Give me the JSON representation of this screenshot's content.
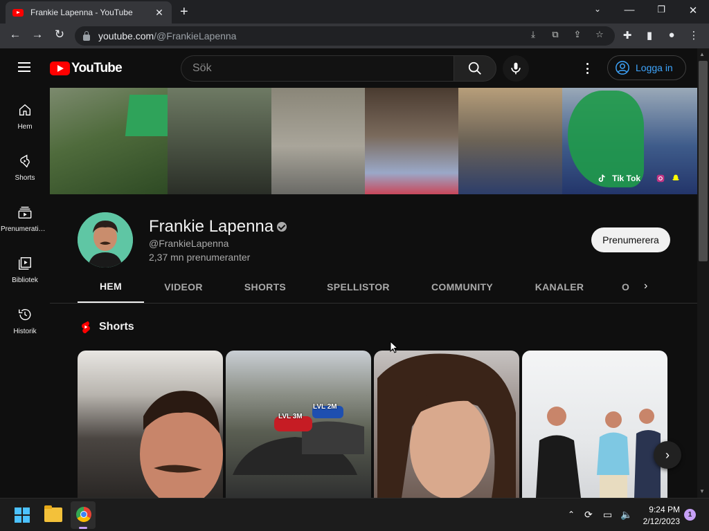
{
  "browser": {
    "tab_title": "Frankie Lapenna - YouTube",
    "url_host": "youtube.com",
    "url_path": "/@FrankieLapenna"
  },
  "masthead": {
    "logo_text": "YouTube",
    "search_placeholder": "Sök",
    "login_label": "Logga in"
  },
  "guide": {
    "items": [
      {
        "label": "Hem",
        "icon": "home-icon"
      },
      {
        "label": "Shorts",
        "icon": "shorts-icon"
      },
      {
        "label": "Prenumerationer",
        "icon": "subscriptions-icon"
      },
      {
        "label": "Bibliotek",
        "icon": "library-icon"
      },
      {
        "label": "Historik",
        "icon": "history-icon"
      }
    ]
  },
  "banner": {
    "social_label": "Tik Tok"
  },
  "channel": {
    "name": "Frankie Lapenna",
    "handle": "@FrankieLapenna",
    "subscribers": "2,37 mn prenumeranter",
    "subscribe_label": "Prenumerera"
  },
  "tabs": [
    {
      "label": "HEM",
      "active": true
    },
    {
      "label": "VIDEOR",
      "active": false
    },
    {
      "label": "SHORTS",
      "active": false
    },
    {
      "label": "SPELLISTOR",
      "active": false
    },
    {
      "label": "COMMUNITY",
      "active": false
    },
    {
      "label": "KANALER",
      "active": false
    },
    {
      "label": "O",
      "active": false
    }
  ],
  "shelf": {
    "title": "Shorts",
    "overlay_labels": [
      "LVL 3M",
      "LVL 2M"
    ]
  },
  "taskbar": {
    "time": "9:24 PM",
    "date": "2/12/2023",
    "notifications": "1"
  },
  "colors": {
    "accent_red": "#ff0000",
    "link_blue": "#3ea6ff",
    "background": "#0f0f0f"
  }
}
